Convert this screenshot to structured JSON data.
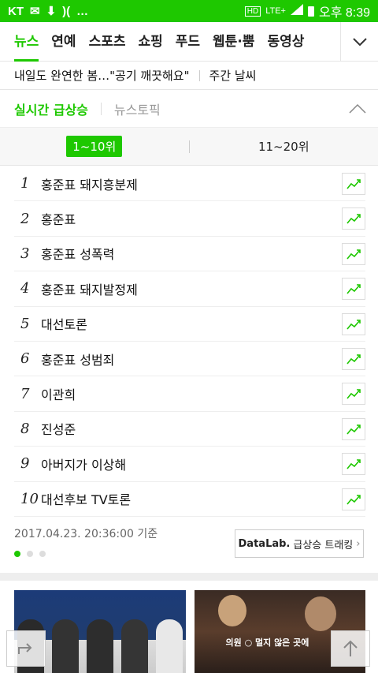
{
  "status": {
    "carrier": "KT",
    "time_label": "오후 8:39",
    "network": "LTE+"
  },
  "tabs": [
    {
      "label": "뉴스",
      "active": true
    },
    {
      "label": "연예",
      "active": false
    },
    {
      "label": "스포츠",
      "active": false
    },
    {
      "label": "쇼핑",
      "active": false
    },
    {
      "label": "푸드",
      "active": false
    },
    {
      "label": "웹툰·뿜",
      "active": false
    },
    {
      "label": "동영상",
      "active": false
    }
  ],
  "headline": {
    "main": "내일도 완연한 봄…\"공기 깨끗해요\"",
    "side": "주간 날씨"
  },
  "section": {
    "tab_realtime": "실시간 급상승",
    "tab_newstopic": "뉴스토픽"
  },
  "range": {
    "tab_1": "1~10위",
    "tab_2": "11~20위"
  },
  "ranking": [
    {
      "rank": "1",
      "keyword": "홍준표 돼지흥분제"
    },
    {
      "rank": "2",
      "keyword": "홍준표"
    },
    {
      "rank": "3",
      "keyword": "홍준표 성폭력"
    },
    {
      "rank": "4",
      "keyword": "홍준표 돼지발정제"
    },
    {
      "rank": "5",
      "keyword": "대선토론"
    },
    {
      "rank": "6",
      "keyword": "홍준표 성범죄"
    },
    {
      "rank": "7",
      "keyword": "이관희"
    },
    {
      "rank": "8",
      "keyword": "진성준"
    },
    {
      "rank": "9",
      "keyword": "아버지가 이상해"
    },
    {
      "rank": "10",
      "keyword": "대선후보 TV토론"
    }
  ],
  "footer": {
    "timestamp": "2017.04.23. 20:36:00 기준",
    "datalab_brand": "DataLab.",
    "datalab_label": "급상승 트래킹"
  },
  "thumb2_caption": "의원 ○ 멀지 않은 곳에"
}
